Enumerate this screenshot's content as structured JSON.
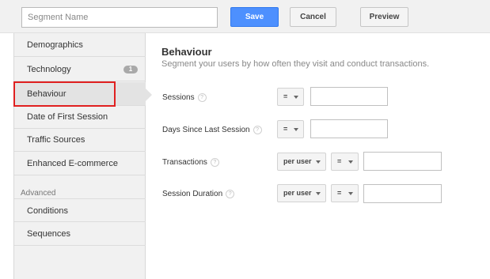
{
  "toolbar": {
    "segment_name_placeholder": "Segment Name",
    "save_label": "Save",
    "cancel_label": "Cancel",
    "preview_label": "Preview"
  },
  "sidebar": {
    "items": [
      {
        "label": "Demographics"
      },
      {
        "label": "Technology",
        "badge": "1"
      },
      {
        "label": "Behaviour"
      },
      {
        "label": "Date of First Session"
      },
      {
        "label": "Traffic Sources"
      },
      {
        "label": "Enhanced E-commerce"
      }
    ],
    "advanced_label": "Advanced",
    "advanced_items": [
      {
        "label": "Conditions"
      },
      {
        "label": "Sequences"
      }
    ]
  },
  "main": {
    "title": "Behaviour",
    "subtitle": "Segment your users by how often they visit and conduct transactions.",
    "help_glyph": "?",
    "rows": [
      {
        "label": "Sessions",
        "operator": "=",
        "value": ""
      },
      {
        "label": "Days Since Last Session",
        "operator": "=",
        "value": ""
      },
      {
        "label": "Transactions",
        "scope": "per user",
        "operator": "=",
        "value": ""
      },
      {
        "label": "Session Duration",
        "scope": "per user",
        "operator": "=",
        "value": ""
      }
    ]
  }
}
